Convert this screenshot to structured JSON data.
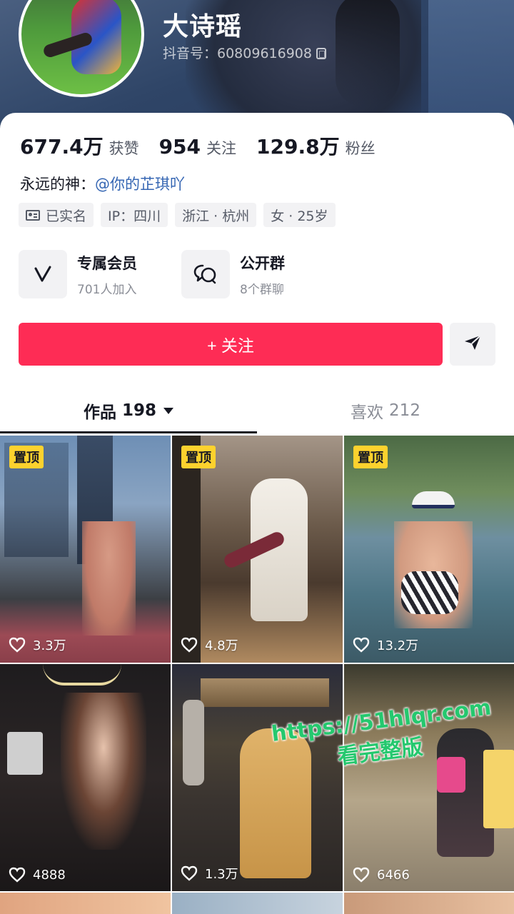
{
  "profile": {
    "name": "大诗瑶",
    "douyin_id": "抖音号：60809616908"
  },
  "stats": [
    {
      "value": "677.4万",
      "label": "获赞"
    },
    {
      "value": "954",
      "label": "关注"
    },
    {
      "value": "129.8万",
      "label": "粉丝"
    }
  ],
  "bio": {
    "prefix": "永远的神：",
    "mention": "@你的芷琪吖"
  },
  "tags": [
    "已实名",
    "IP：四川",
    "浙江 · 杭州",
    "女 · 25岁"
  ],
  "features": [
    {
      "title": "专属会员",
      "subtitle": "701人加入",
      "icon": "vip-v-icon"
    },
    {
      "title": "公开群",
      "subtitle": "8个群聊",
      "icon": "group-chat-icon"
    }
  ],
  "actions": {
    "follow_label": "+ 关注",
    "send_icon": "send-icon"
  },
  "tabs": {
    "works_label": "作品",
    "works_count": "198",
    "likes_label": "喜欢",
    "likes_count": "212"
  },
  "videos": [
    {
      "pinned": true,
      "pin_label": "置顶",
      "likes": "3.3万"
    },
    {
      "pinned": true,
      "pin_label": "置顶",
      "likes": "4.8万"
    },
    {
      "pinned": true,
      "pin_label": "置顶",
      "likes": "13.2万"
    },
    {
      "pinned": false,
      "likes": "4888"
    },
    {
      "pinned": false,
      "likes": "1.3万"
    },
    {
      "pinned": false,
      "likes": "6466"
    }
  ],
  "watermark": {
    "url": "https://51hlqr.com",
    "text": "看完整版"
  },
  "colors": {
    "follow": "#fe2c55",
    "pin": "#fdd22e",
    "mention": "#3566b3"
  }
}
